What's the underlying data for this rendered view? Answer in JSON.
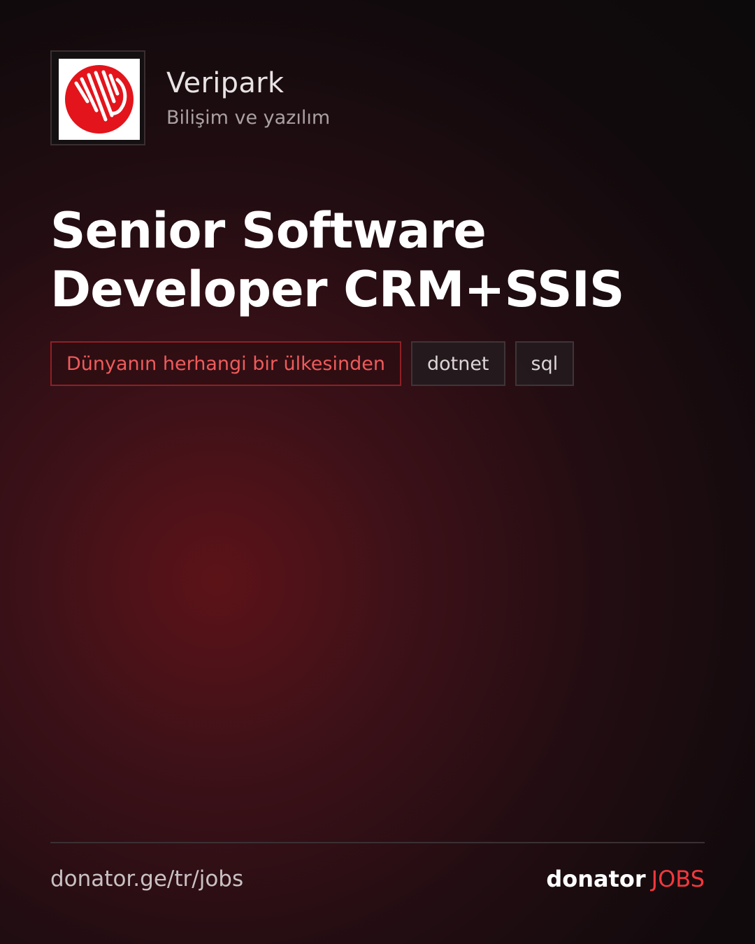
{
  "company": {
    "name": "Veripark",
    "category": "Bilişim ve yazılım",
    "logo_icon": "veripark-logo-icon"
  },
  "job": {
    "title": "Senior Software Developer CRM+SSIS"
  },
  "tags": {
    "location": "Dünyanın herhangi bir ülkesinden",
    "skills": [
      "dotnet",
      "sql"
    ]
  },
  "footer": {
    "url": "donator.ge/tr/jobs",
    "brand": {
      "main": "donator",
      "accent": "JOBS"
    }
  },
  "colors": {
    "accent": "#f2383d",
    "logo_red": "#e3141b",
    "background": "#0d0a0b"
  }
}
